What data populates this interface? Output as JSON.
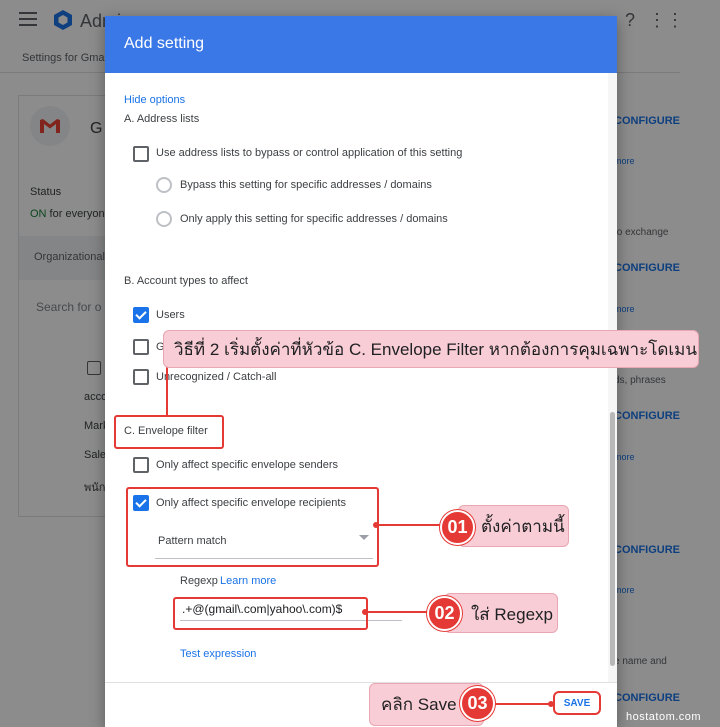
{
  "background": {
    "brand": "Admi",
    "breadcrumb": "Settings for Gma",
    "app_initial": "G",
    "status_label": "Status",
    "status_on": "ON",
    "status_rest": " for everyon",
    "org_label": "Organizational",
    "search_placeholder": "Search for o",
    "left_items": [
      "acco",
      "Mark",
      "Sale",
      "พนัก"
    ],
    "right_links": [
      "CONFIGURE",
      "CONFIGURE",
      "CONFIGURE",
      "CONFIGURE",
      "CONFIGURE"
    ],
    "right_more": "more",
    "right_texts": [
      "to exchange",
      "ds, phrases",
      "e name and"
    ]
  },
  "dialog": {
    "title": "Add setting",
    "hide_options": "Hide options",
    "section_a": "A. Address lists",
    "use_address_lists": "Use address lists to bypass or control application of this setting",
    "bypass_option": "Bypass this setting for specific addresses / domains",
    "only_apply_option": "Only apply this setting for specific addresses / domains",
    "section_b": "B. Account types to affect",
    "users": "Users",
    "groups_partial": "G",
    "unrecognized": "Unrecognized / Catch-all",
    "section_c": "C. Envelope filter",
    "only_senders": "Only affect specific envelope senders",
    "only_recipients": "Only affect specific envelope recipients",
    "match_type": "Pattern match",
    "regexp_label": "Regexp",
    "learn_more": "Learn more",
    "regexp_value": ".+@(gmail\\.com|yahoo\\.com)$",
    "test_expression": "Test expression",
    "save": "SAVE"
  },
  "checkbox_state": {
    "use_address_lists": false,
    "users": true,
    "groups": false,
    "unrecognized": false,
    "only_senders": false,
    "only_recipients": true
  },
  "annotations": {
    "method_note": "วิธีที่ 2 เริ่มตั้งค่าที่หัวข้อ C. Envelope Filter หากต้องการคุมเฉพาะโดเมน",
    "step1_num": "01",
    "step1_text": "ตั้งค่าตามนี้",
    "step2_num": "02",
    "step2_text": "ใส่ Regexp",
    "step3_num": "03",
    "step3_text": "คลิก Save",
    "watermark": "hostatom.com",
    "accent_red": "#e53935",
    "callout_pink": "#f9cdd5"
  },
  "colors": {
    "dialog_header": "#3b78e7",
    "link_blue": "#1a73e8"
  }
}
